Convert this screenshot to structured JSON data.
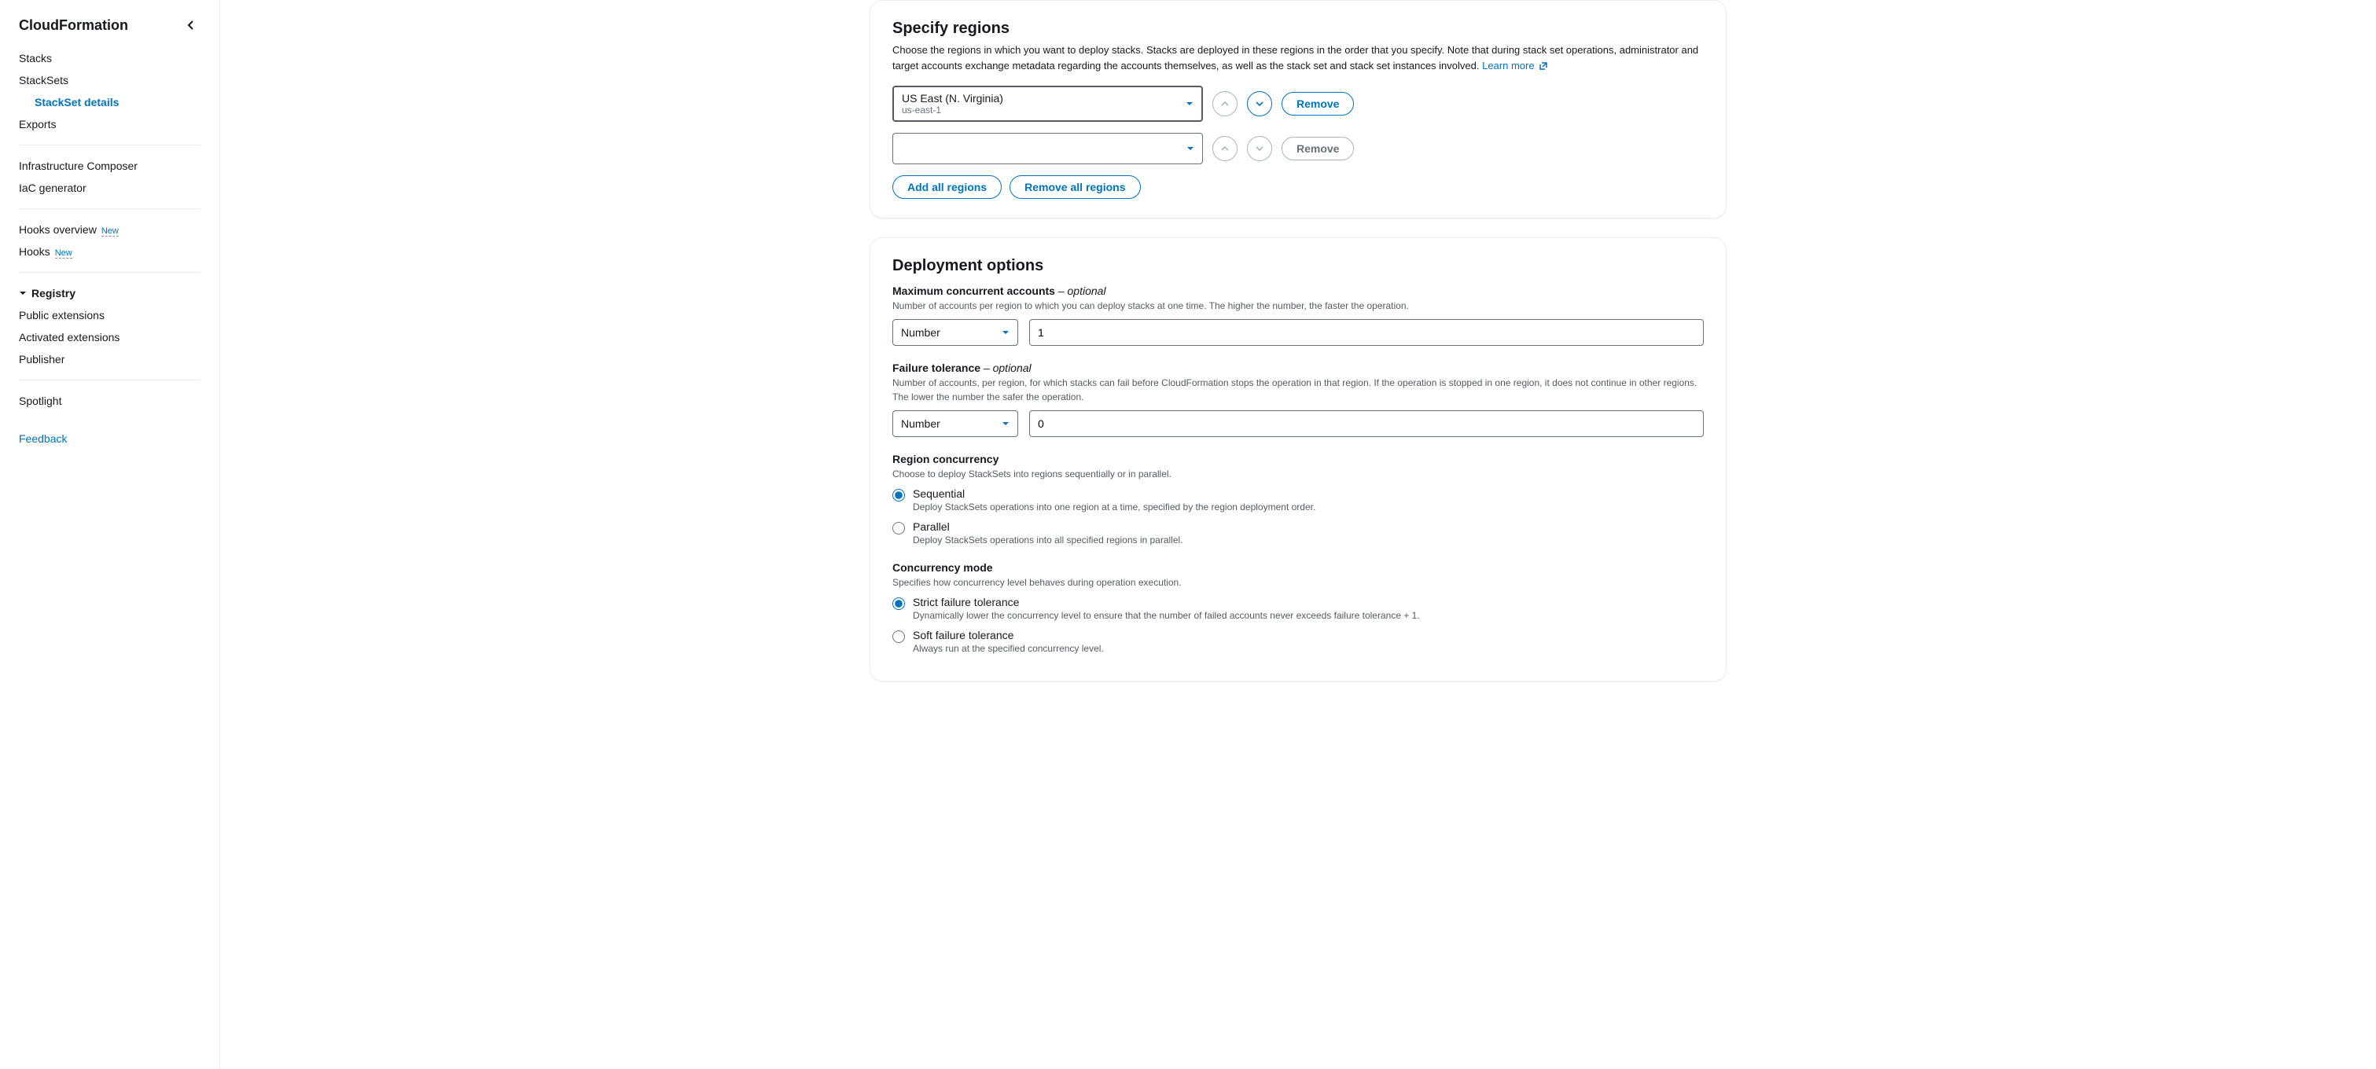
{
  "sidebar": {
    "title": "CloudFormation",
    "items": [
      {
        "label": "Stacks"
      },
      {
        "label": "StackSets"
      },
      {
        "label": "StackSet details",
        "indent": true,
        "active": true
      },
      {
        "label": "Exports"
      }
    ],
    "group2": [
      {
        "label": "Infrastructure Composer"
      },
      {
        "label": "IaC generator"
      }
    ],
    "group3": [
      {
        "label": "Hooks overview",
        "badge": "New"
      },
      {
        "label": "Hooks",
        "badge": "New"
      }
    ],
    "registry_label": "Registry",
    "registry_items": [
      {
        "label": "Public extensions"
      },
      {
        "label": "Activated extensions"
      },
      {
        "label": "Publisher"
      }
    ],
    "group5": [
      {
        "label": "Spotlight"
      }
    ],
    "feedback": "Feedback"
  },
  "regions": {
    "title": "Specify regions",
    "description": "Choose the regions in which you want to deploy stacks. Stacks are deployed in these regions in the order that you specify. Note that during stack set operations, administrator and target accounts exchange metadata regarding the accounts themselves, as well as the stack set and stack set instances involved. ",
    "learn_more": "Learn more",
    "rows": [
      {
        "name": "US East (N. Virginia)",
        "code": "us-east-1",
        "remove_label": "Remove",
        "up_enabled": false,
        "down_enabled": true,
        "remove_enabled": true
      },
      {
        "name": "",
        "code": "",
        "remove_label": "Remove",
        "up_enabled": false,
        "down_enabled": false,
        "remove_enabled": false
      }
    ],
    "add_all": "Add all regions",
    "remove_all": "Remove all regions"
  },
  "deployment": {
    "title": "Deployment options",
    "max_concurrent": {
      "label": "Maximum concurrent accounts",
      "optional": " – optional",
      "hint": "Number of accounts per region to which you can deploy stacks at one time. The higher the number, the faster the operation.",
      "type": "Number",
      "value": "1"
    },
    "failure_tolerance": {
      "label": "Failure tolerance",
      "optional": " – optional",
      "hint": "Number of accounts, per region, for which stacks can fail before CloudFormation stops the operation in that region. If the operation is stopped in one region, it does not continue in other regions. The lower the number the safer the operation.",
      "type": "Number",
      "value": "0"
    },
    "region_concurrency": {
      "label": "Region concurrency",
      "hint": "Choose to deploy StackSets into regions sequentially or in parallel.",
      "options": [
        {
          "label": "Sequential",
          "desc": "Deploy StackSets operations into one region at a time, specified by the region deployment order.",
          "checked": true
        },
        {
          "label": "Parallel",
          "desc": "Deploy StackSets operations into all specified regions in parallel.",
          "checked": false
        }
      ]
    },
    "concurrency_mode": {
      "label": "Concurrency mode",
      "hint": "Specifies how concurrency level behaves during operation execution.",
      "options": [
        {
          "label": "Strict failure tolerance",
          "desc": "Dynamically lower the concurrency level to ensure that the number of failed accounts never exceeds failure tolerance + 1.",
          "checked": true
        },
        {
          "label": "Soft failure tolerance",
          "desc": "Always run at the specified concurrency level.",
          "checked": false
        }
      ]
    }
  }
}
